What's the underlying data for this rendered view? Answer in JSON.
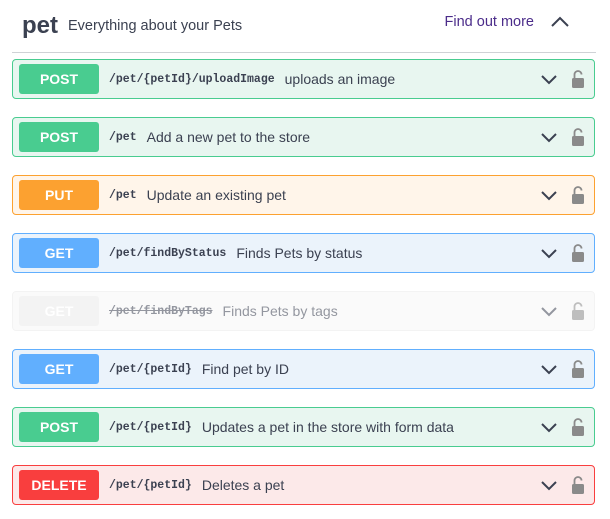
{
  "tag": {
    "name": "pet",
    "description": "Everything about your Pets",
    "find_out_more": "Find out more"
  },
  "operations": [
    {
      "method": "POST",
      "path": "/pet/{petId}/uploadImage",
      "summary": "uploads an image"
    },
    {
      "method": "POST",
      "path": "/pet",
      "summary": "Add a new pet to the store"
    },
    {
      "method": "PUT",
      "path": "/pet",
      "summary": "Update an existing pet"
    },
    {
      "method": "GET",
      "path": "/pet/findByStatus",
      "summary": "Finds Pets by status"
    },
    {
      "method": "GET",
      "path": "/pet/findByTags",
      "summary": "Finds Pets by tags",
      "deprecated": true
    },
    {
      "method": "GET",
      "path": "/pet/{petId}",
      "summary": "Find pet by ID"
    },
    {
      "method": "POST",
      "path": "/pet/{petId}",
      "summary": "Updates a pet in the store with form data"
    },
    {
      "method": "DELETE",
      "path": "/pet/{petId}",
      "summary": "Deletes a pet"
    }
  ],
  "colors": {
    "post": {
      "badge": "#49cc90",
      "border": "#49cc90",
      "bg": "#e8f6f0"
    },
    "put": {
      "badge": "#fca130",
      "border": "#fca130",
      "bg": "#fff5ea"
    },
    "get": {
      "badge": "#61affe",
      "border": "#61affe",
      "bg": "#ebf3fb"
    },
    "delete": {
      "badge": "#f93e3e",
      "border": "#f93e3e",
      "bg": "#fce9e9"
    },
    "deprecated": {
      "badge": "#ebebeb",
      "border": "#ebebeb",
      "bg": "#f7f7f7"
    },
    "link": "#4b2c8a",
    "text": "#3b4151"
  },
  "icons": {
    "collapse": "chevron-up-icon",
    "expand": "chevron-down-icon",
    "auth": "lock-icon"
  }
}
